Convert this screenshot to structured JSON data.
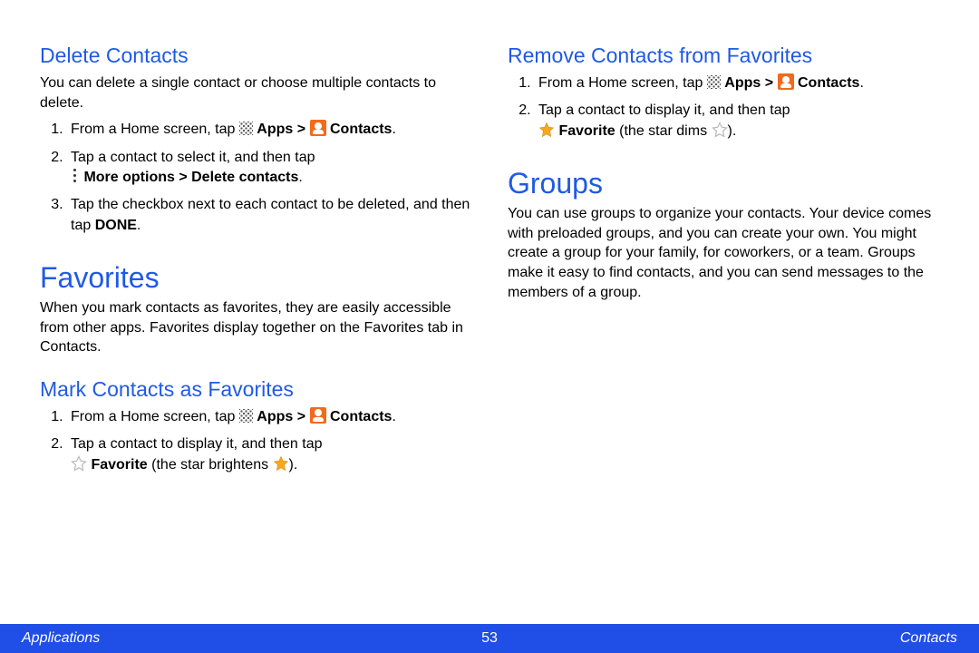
{
  "left": {
    "h_delete": "Delete Contacts",
    "p_delete": "You can delete a single contact or choose multiple contacts to delete.",
    "s1_a": "From a Home screen, tap ",
    "s1_apps": "Apps > ",
    "s1_contacts": "Contacts",
    "s1_end": ".",
    "s2_a": "Tap a contact to select it, and then tap",
    "s2_b": "More options > Delete contacts",
    "s2_end": ".",
    "s3_a": "Tap the checkbox next to each contact to be deleted, and then tap ",
    "s3_b": "DONE",
    "s3_end": ".",
    "h_fav": "Favorites",
    "p_fav": "When you mark contacts as favorites, they are easily accessible from other apps. Favorites display together on the Favorites tab in Contacts.",
    "h_mark": "Mark Contacts as Favorites",
    "m2_a": "Tap a contact to display it, and then tap",
    "m2_fav": "Favorite",
    "m2_b": " (the star brightens ",
    "m2_c": ")."
  },
  "right": {
    "h_remove": "Remove Contacts from Favorites",
    "r2_a": "Tap a contact to display it, and then tap",
    "r2_fav": "Favorite",
    "r2_b": " (the star dims ",
    "r2_c": ").",
    "h_groups": "Groups",
    "p_groups": "You can use groups to organize your contacts. Your device comes with preloaded groups, and you can create your own. You might create a group for your family, for coworkers, or a team. Groups make it easy to find contacts, and you can send messages to the members of a group."
  },
  "footer": {
    "left": "Applications",
    "page": "53",
    "right": "Contacts"
  }
}
